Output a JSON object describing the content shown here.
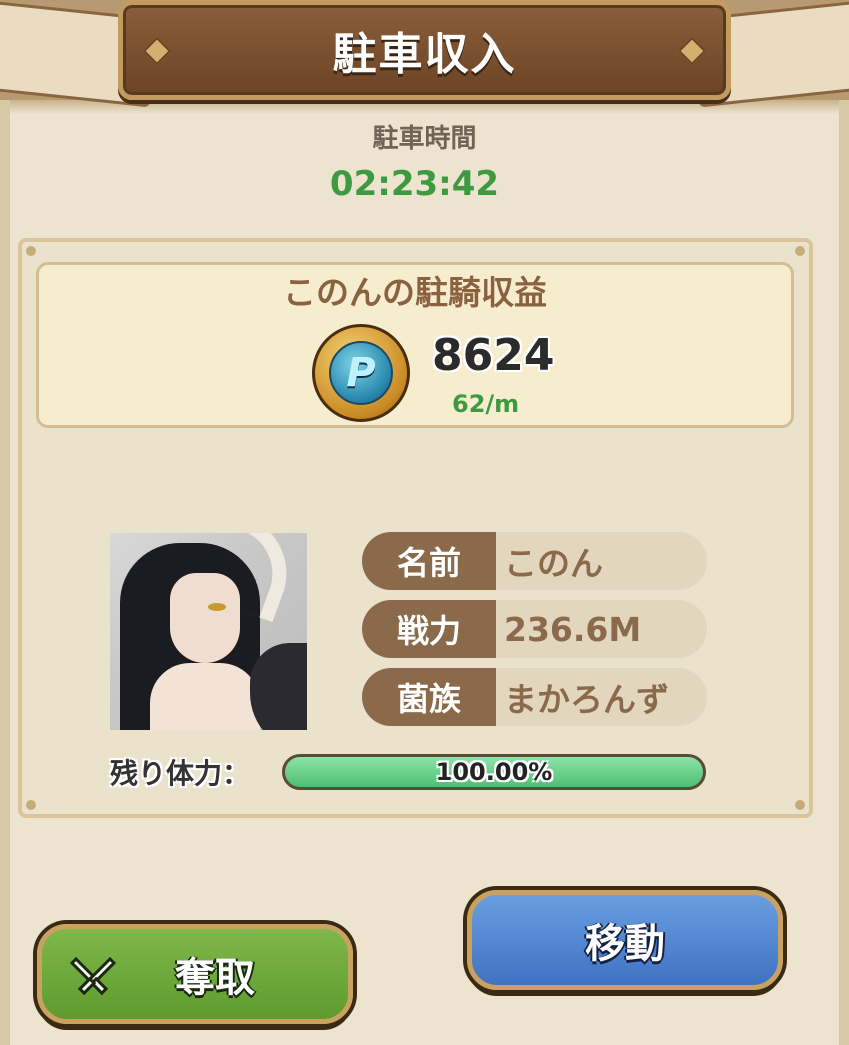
{
  "header": {
    "title": "駐車収入"
  },
  "parking": {
    "time_label": "駐車時間",
    "time_value": "02:23:42"
  },
  "income": {
    "title": "このんの駐騎収益",
    "coin_icon": "p-coin-icon",
    "coin_glyph": "P",
    "amount": "8624",
    "rate": "62/m"
  },
  "profile": {
    "rows": [
      {
        "key": "名前",
        "value": "このん"
      },
      {
        "key": "戦力",
        "value": "236.6M"
      },
      {
        "key": "菌族",
        "value": "まかろんず"
      }
    ]
  },
  "stamina": {
    "label": "残り体力：",
    "percent_text": "100.00%",
    "fraction": 1.0
  },
  "buttons": {
    "steal": "奪取",
    "move": "移動"
  },
  "colors": {
    "accent_green": "#3d9a40",
    "brown": "#8b6a4c"
  }
}
